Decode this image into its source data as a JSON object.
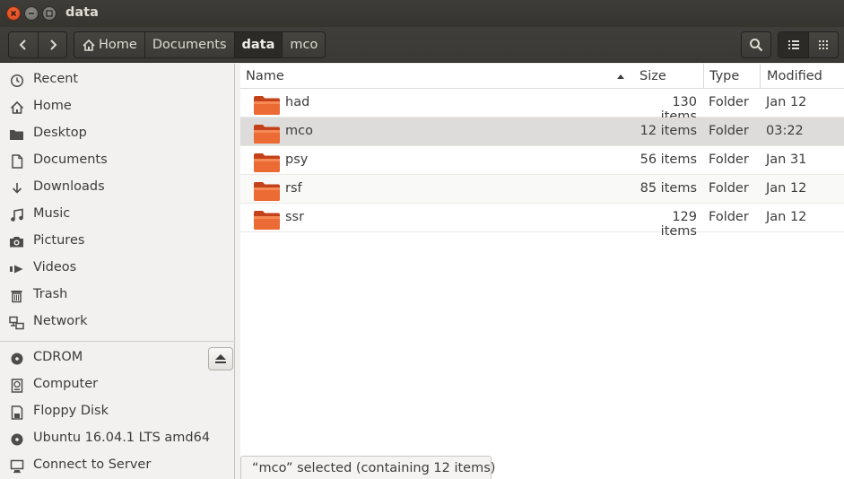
{
  "window": {
    "title": "data"
  },
  "header": {
    "breadcrumbs": [
      {
        "label": "Home",
        "icon": "home-icon"
      },
      {
        "label": "Documents"
      },
      {
        "label": "data"
      },
      {
        "label": "mco"
      }
    ]
  },
  "sidebar": {
    "places": [
      {
        "label": "Recent",
        "icon": "clock-icon"
      },
      {
        "label": "Home",
        "icon": "home-icon"
      },
      {
        "label": "Desktop",
        "icon": "desktop-folder-icon"
      },
      {
        "label": "Documents",
        "icon": "document-icon"
      },
      {
        "label": "Downloads",
        "icon": "download-icon"
      },
      {
        "label": "Music",
        "icon": "music-icon"
      },
      {
        "label": "Pictures",
        "icon": "camera-icon"
      },
      {
        "label": "Videos",
        "icon": "video-icon"
      },
      {
        "label": "Trash",
        "icon": "trash-icon"
      },
      {
        "label": "Network",
        "icon": "network-icon"
      }
    ],
    "devices": [
      {
        "label": "CDROM",
        "icon": "disc-icon"
      },
      {
        "label": "Computer",
        "icon": "drive-icon"
      },
      {
        "label": "Floppy Disk",
        "icon": "floppy-icon"
      },
      {
        "label": "Ubuntu 16.04.1 LTS amd64",
        "icon": "disc-icon"
      },
      {
        "label": "Connect to Server",
        "icon": "server-icon"
      }
    ]
  },
  "table": {
    "columns": {
      "name": "Name",
      "size": "Size",
      "type": "Type",
      "modified": "Modified"
    },
    "rows": [
      {
        "name": "had",
        "size": "130 items",
        "type": "Folder",
        "modified": "Jan 12"
      },
      {
        "name": "mco",
        "size": "12 items",
        "type": "Folder",
        "modified": "03:22"
      },
      {
        "name": "psy",
        "size": "56 items",
        "type": "Folder",
        "modified": "Jan 31"
      },
      {
        "name": "rsf",
        "size": "85 items",
        "type": "Folder",
        "modified": "Jan 12"
      },
      {
        "name": "ssr",
        "size": "129 items",
        "type": "Folder",
        "modified": "Jan 12"
      }
    ]
  },
  "status": {
    "text": "“mco” selected  (containing 12 items)"
  },
  "colors": {
    "titlebar": "#3e3d39",
    "close_button": "#e95420",
    "selection": "#dedcda",
    "folder_orange": "#e8632e"
  }
}
